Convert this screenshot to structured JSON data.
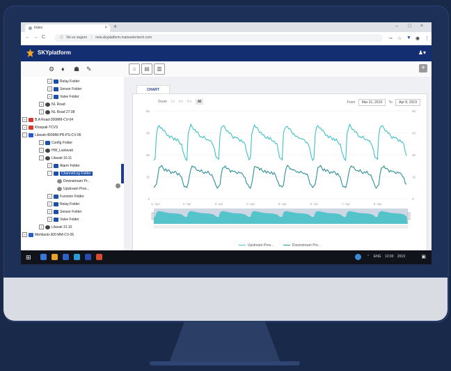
{
  "browser": {
    "tab_title": "Index",
    "tab_close": "×",
    "new_tab": "+",
    "win_min": "–",
    "win_max": "□",
    "win_close": "×",
    "back": "←",
    "forward": "→",
    "reload": "C",
    "info": "ⓘ",
    "security": "No es seguro",
    "url": "new.skyplatform.matsoetentech.com",
    "icon_key": "⊸",
    "icon_star": "☆",
    "icon_shield": "▼",
    "icon_account": "◉",
    "icon_menu": "⋮"
  },
  "app": {
    "name": "SKYplatform",
    "user": "♟▾",
    "brand_color": "#132f71"
  },
  "toolbar": {
    "settings": "⚙",
    "drop": "♦",
    "users": "☗",
    "wrench": "✎",
    "btn_home": "⌂",
    "btn_doc": "▤",
    "btn_chart": "▥",
    "add": "+"
  },
  "tree": {
    "items": [
      {
        "label": "Relay Folder",
        "exp": "+",
        "icon": "folder"
      },
      {
        "label": "Sensor Folder",
        "exp": "+",
        "icon": "folder"
      },
      {
        "label": "Valve Folder",
        "exp": "+",
        "icon": "folder"
      },
      {
        "label": "NL Road",
        "exp": "+",
        "icon": "node"
      },
      {
        "label": "NL Road 27.08",
        "exp": "+",
        "icon": "node"
      },
      {
        "label": "B.A Road-300MM-CV-04",
        "exp": "+",
        "icon": "device-red"
      },
      {
        "label": "Kharpali-TCVS",
        "exp": "+",
        "icon": "device-red"
      },
      {
        "label": "Lilavati-450MM-PR-PS-CV-06",
        "exp": "−",
        "icon": "device-blue"
      },
      {
        "label": "Config Folder",
        "exp": "−",
        "icon": "folder"
      },
      {
        "label": "HW_Lavlavati",
        "exp": "+",
        "icon": "node"
      },
      {
        "label": "Lilavati 10.11",
        "exp": "−",
        "icon": "node"
      },
      {
        "label": "Alarm Folder",
        "exp": "+",
        "icon": "folder"
      },
      {
        "label": "ChannelLog Folder",
        "exp": "−",
        "icon": "folder"
      },
      {
        "label": "Downstream Pr...",
        "exp": "",
        "icon": "channel"
      },
      {
        "label": "Upstream Pres...",
        "exp": "",
        "icon": "channel"
      },
      {
        "label": "Function Folder",
        "exp": "+",
        "icon": "folder"
      },
      {
        "label": "Relay Folder",
        "exp": "+",
        "icon": "folder"
      },
      {
        "label": "Sensor Folder",
        "exp": "+",
        "icon": "folder"
      },
      {
        "label": "Valve Folder",
        "exp": "+",
        "icon": "folder"
      },
      {
        "label": "Lilavati 31.10",
        "exp": "+",
        "icon": "node"
      },
      {
        "label": "Mehboob-300 MM-CV-05",
        "exp": "+",
        "icon": "device-blue"
      }
    ]
  },
  "chart_panel": {
    "tab": "CHART",
    "zoom_label": "Zoom",
    "zoom_options": [
      "1d",
      "1m",
      "6m",
      "All"
    ],
    "from_label": "From",
    "from_date": "Mar 31, 2019",
    "to_label": "To",
    "to_date": "Apr 8, 2019"
  },
  "chart_data": {
    "type": "line",
    "title": "",
    "xlabel": "",
    "ylabel": "",
    "ylim": [
      0,
      60
    ],
    "y_ticks": [
      "0",
      "15",
      "30",
      "45",
      "60"
    ],
    "y_ticks_right": [
      "0",
      "15",
      "30",
      "45",
      "60"
    ],
    "x_ticks": [
      "1. Apr",
      "2. Apr",
      "3. Apr",
      "4. Apr",
      "5. Apr",
      "6. Apr",
      "7. Apr",
      "8. Apr"
    ],
    "series": [
      {
        "name": "Upstream Pres...",
        "color": "#3ec1c6",
        "pattern": [
          27,
          27,
          44,
          48,
          50,
          49,
          48,
          47,
          46,
          45,
          44,
          43,
          42,
          42,
          42,
          41,
          41,
          40,
          40,
          39,
          38,
          37,
          33,
          29
        ]
      },
      {
        "name": "Downstream Pre...",
        "color": "#2a8f95",
        "pattern": [
          8,
          8,
          10,
          16,
          21,
          22,
          22,
          21,
          20,
          20,
          19,
          19,
          19,
          18,
          18,
          18,
          18,
          18,
          17,
          17,
          16,
          14,
          11,
          9
        ]
      }
    ],
    "days": 8,
    "navigator_color": "#3ec1c6"
  },
  "taskbar": {
    "start": "⊞",
    "tray": [
      "⌃",
      "ENG",
      "12:00",
      "2019"
    ],
    "notify": "▣"
  }
}
